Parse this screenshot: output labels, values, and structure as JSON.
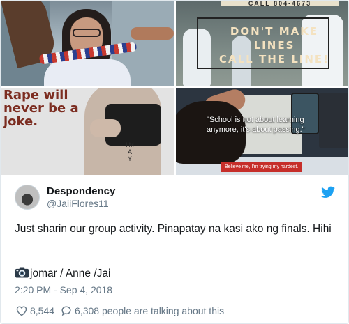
{
  "images": {
    "tile2_sign_top": "CALL 804-4673",
    "tile2_sign": [
      "DON'T MAKE",
      "LINES",
      "CALL THE LINE!"
    ],
    "tile3_text": [
      "Rape will",
      "never be a",
      "joke."
    ],
    "tile3_body_writing": [
      "I'M",
      "A",
      "Y"
    ],
    "tile4_quote": "\"School is not about learning anymore, it's about passing.\"",
    "tile4_caption": "Believe me, I'm trying my hardest."
  },
  "tweet": {
    "display_name": "Despondency",
    "handle": "@JaiiFlores11",
    "text": "Just sharin our group activity. Pinapatay na kasi ako ng finals. Hihi",
    "credit": "jomar / Anne /Jai",
    "credit_icon": "camera-icon",
    "timestamp": "2:20 PM - Sep 4, 2018",
    "likes": "8,544",
    "talking": "6,308 people are talking about this",
    "brand_color": "#1da1f2"
  }
}
